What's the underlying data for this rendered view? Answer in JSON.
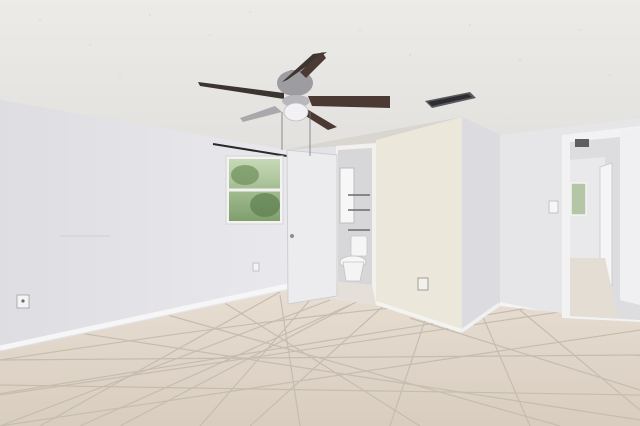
{
  "scene": {
    "kind": "photo",
    "colors": {
      "ceiling": "#e8e7e4",
      "wall_left": "#e4e3e6",
      "wall_center": "#e9e5d8",
      "wall_right": "#e6e6e8",
      "floor_tile": "#ddd3c6",
      "grout": "#c9bfb2",
      "fan_blade": "#4a3a33",
      "window_glass": "#9bb58a",
      "door": "#ecebed",
      "baseboard": "#f4f4f4"
    },
    "objects": [
      "ceiling-fan",
      "air-vent",
      "window",
      "curtain-rod",
      "open-door",
      "bathroom-doorway",
      "toilet",
      "hallway-doorway",
      "light-switch",
      "wall-outlet",
      "tile-floor"
    ]
  }
}
